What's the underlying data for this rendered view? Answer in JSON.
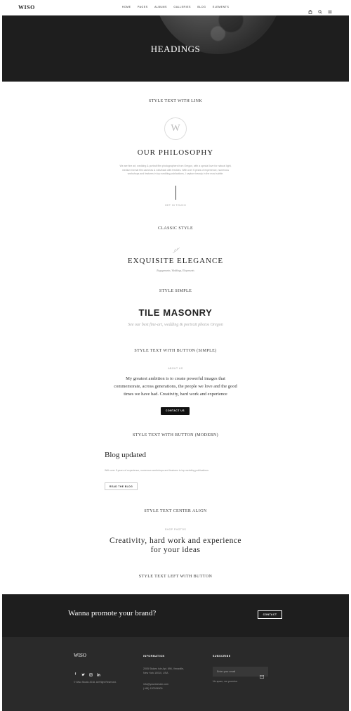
{
  "header": {
    "logo": "WISO",
    "nav": [
      "HOME",
      "PAGES",
      "ALBUMS",
      "GALLERIES",
      "BLOG",
      "ELEMENTS"
    ]
  },
  "hero": {
    "title": "HEADINGS"
  },
  "sections": {
    "s1": {
      "label": "STYLE TEXT WITH LINK",
      "badge": "W",
      "title": "OUR PHILOSOPHY",
      "text1": "We are fine art, wedding & portrait film photographers from Oregon, with a special love for natural light,",
      "text2": "medium format film cameras & rolls/back with freckles. With over 5 years of experience, numerous",
      "text3": "workshops and features in top wedding publications, I capture beauty in the most subtle.",
      "link": "GET IN TOUCH"
    },
    "s2": {
      "label": "CLASSIC STYLE",
      "title": "EXQUISITE ELEGANCE",
      "sub": "Engagements, Weddings, Elopements"
    },
    "s3": {
      "label": "STYLE SIMPLE",
      "title": "TILE MASONRY",
      "sub": "See our best fine-art, wedding & portrait photos Oregon"
    },
    "s4": {
      "label": "STYLE TEXT WITH BUTTON (SIMPLE)",
      "kicker": "ABOUT US",
      "line1": "My greatest ambition is to create powerful images that",
      "line2": "commemorate, across generations, the people we love and the good",
      "line3": "times we have had. Creativity, hard work and experience",
      "button": "CONTACT US"
    },
    "s5": {
      "label": "STYLE TEXT WITH BUTTON (MODERN)",
      "title": "Blog updated",
      "text": "With over 5 years of experience, numerous workshops and features in top wedding publications.",
      "button": "READ THE BLOG"
    },
    "s6": {
      "label": "STYLE TEXT CENTER ALIGN",
      "kicker": "SHOP PHOTOS",
      "line1": "Creativity, hard work and experience",
      "line2": "for your ideas"
    },
    "s7": {
      "label": "STYLE TEXT LEFT WITH BUTTON"
    }
  },
  "promo": {
    "text": "Wanna promote your brand?",
    "button": "CONTACT"
  },
  "footer": {
    "logo": "WISO",
    "copyright": "© Wiso Studio 2018. All Right Reserved.",
    "info_title": "INFORMATION",
    "addr1": "2005 Stokes Isle Apt. 896, Venaville,",
    "addr2": "New York 10010, USA",
    "email": "info@yourdomain.com",
    "phone": "(+68) 120034509",
    "sub_title": "SUBSCRIBE",
    "email_placeholder": "Enter your email",
    "spam": "No spam, we promise."
  }
}
